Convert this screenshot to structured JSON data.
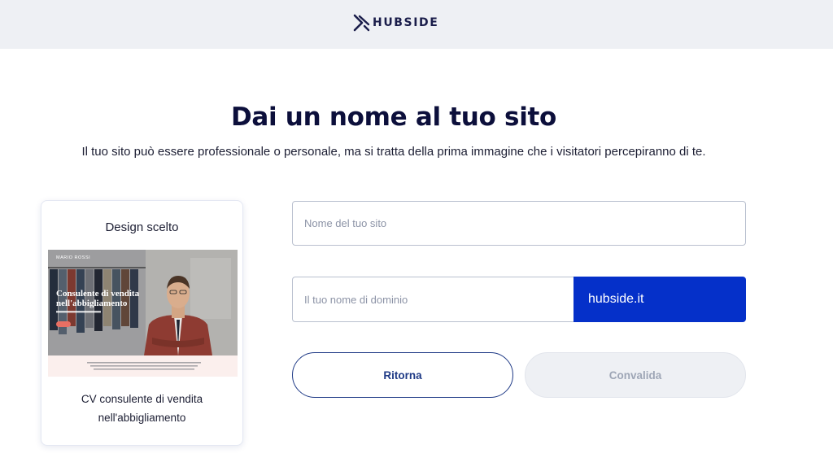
{
  "header": {
    "logo_text": "HUBSIDE",
    "logo_icon": "hubside-x-arrow-icon"
  },
  "page": {
    "title": "Dai un nome al tuo sito",
    "subtitle": "Il tuo sito può essere professionale o personale, ma si tratta della prima immagine che i visitatori percepiranno di te."
  },
  "design_card": {
    "heading": "Design scelto",
    "caption_line1": "CV consulente di vendita",
    "caption_line2": "nell'abbigliamento",
    "thumbnail": {
      "brand": "MARIO ROSSI",
      "headline_line1": "Consulente di vendita",
      "headline_line2": "nell'abbigliamento"
    }
  },
  "form": {
    "site_name_placeholder": "Nome del tuo sito",
    "domain_placeholder": "Il tuo nome di dominio",
    "domain_suffix": "hubside.it"
  },
  "buttons": {
    "back_label": "Ritorna",
    "validate_label": "Convalida"
  },
  "colors": {
    "accent": "#0530c9",
    "header_bg": "#eef0f4",
    "title": "#0c0f3b",
    "back_button_border": "#1f3a86",
    "disabled_text": "#9ea6b6"
  }
}
